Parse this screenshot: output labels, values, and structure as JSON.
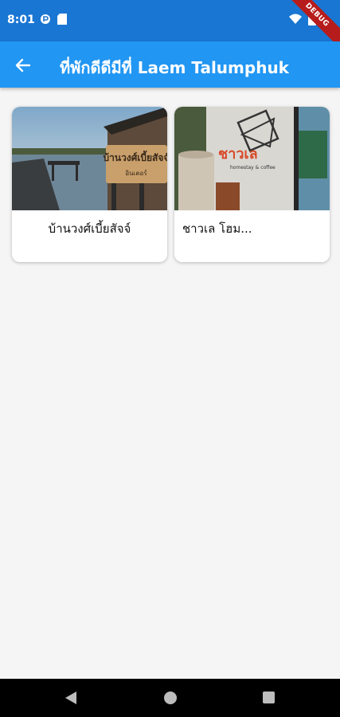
{
  "status_bar": {
    "time": "8:01",
    "debug_label": "DEBUG"
  },
  "app_bar": {
    "title": "ที่พักดีดีมีที่ Laem Talumphuk",
    "back_icon": "arrow-left-icon"
  },
  "cards": [
    {
      "title": "บ้านวงศ์เบี้ยสัจจ์",
      "image": "waterfront-pier-photo"
    },
    {
      "title": "ชาวเล โฮม...",
      "image": "homestay-wall-sign-photo"
    }
  ],
  "colors": {
    "status_bar": "#1976d2",
    "app_bar": "#2196f3",
    "background": "#f5f5f5",
    "ribbon": "#b71c1c"
  }
}
